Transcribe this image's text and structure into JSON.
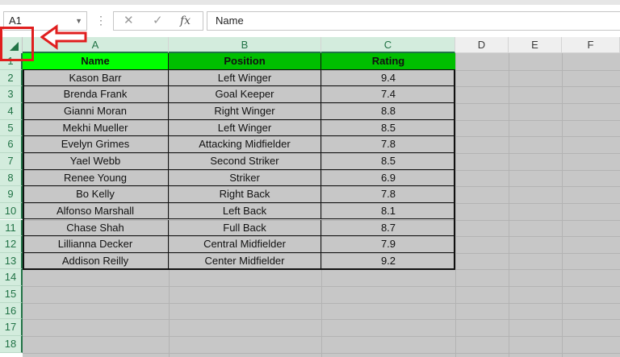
{
  "formula_bar": {
    "name_box": "A1",
    "cancel_icon": "✕",
    "enter_icon": "✓",
    "fx_label": "fx",
    "formula": "Name"
  },
  "columns": [
    "A",
    "B",
    "C",
    "D",
    "E",
    "F"
  ],
  "rows": [
    "1",
    "2",
    "3",
    "4",
    "5",
    "6",
    "7",
    "8",
    "9",
    "10",
    "11",
    "12",
    "13",
    "14",
    "15",
    "16",
    "17",
    "18"
  ],
  "sheet": {
    "headers": [
      "Name",
      "Position",
      "Rating"
    ],
    "data": [
      [
        "Kason Barr",
        "Left Winger",
        "9.4"
      ],
      [
        "Brenda Frank",
        "Goal Keeper",
        "7.4"
      ],
      [
        "Gianni Moran",
        "Right Winger",
        "8.8"
      ],
      [
        "Mekhi Mueller",
        "Left Winger",
        "8.5"
      ],
      [
        "Evelyn Grimes",
        "Attacking Midfielder",
        "7.8"
      ],
      [
        "Yael Webb",
        "Second Striker",
        "8.5"
      ],
      [
        "Renee Young",
        "Striker",
        "6.9"
      ],
      [
        "Bo Kelly",
        "Right Back",
        "7.8"
      ],
      [
        "Alfonso Marshall",
        "Left Back",
        "8.1"
      ],
      [
        "Chase Shah",
        "Full Back",
        "8.7"
      ],
      [
        "Lillianna Decker",
        "Central Midfielder",
        "7.9"
      ],
      [
        "Addison Reilly",
        "Center Midfielder",
        "9.2"
      ]
    ]
  },
  "colors": {
    "selection_green": "#217346",
    "header_fill_a": "#00ff00",
    "header_fill_bc": "#00bf00",
    "sheet_fill": "#c7c7c7",
    "annotation_red": "#e01e1e"
  }
}
